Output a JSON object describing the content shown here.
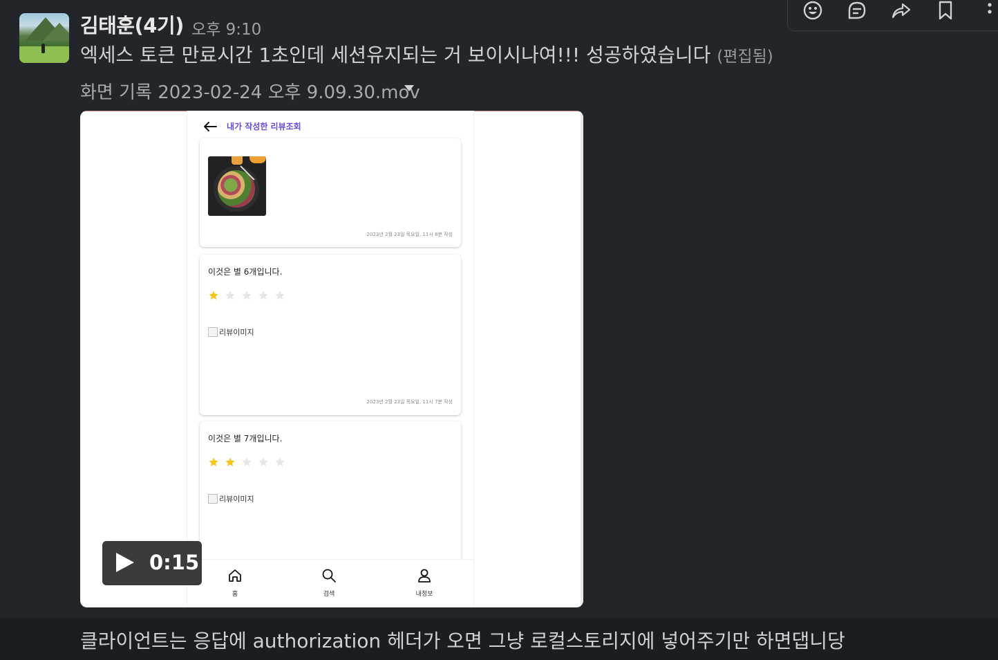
{
  "message": {
    "sender": "김태훈(4기)",
    "time": "오후 9:10",
    "text": "엑세스 토큰 만료시간 1초인데 세션유지되는 거 보이시나여!!! 성공하였습니다",
    "edited_label": "(편집됨)",
    "attachment_name": "화면 기록 2023-02-24 오후 9.09.30.mov",
    "video_duration": "0:15"
  },
  "toolbar": {
    "icons": [
      "emoji-icon",
      "reply-thread-icon",
      "share-icon",
      "bookmark-icon",
      "more-icon"
    ]
  },
  "app": {
    "header_title": "내가 작성한 리뷰조회",
    "cards": [
      {
        "date": "2023년 2월 23일 목요일, 11시 8분 작성"
      },
      {
        "text": "이것은 별 6개입니다.",
        "rating": 1,
        "image_alt": "리뷰이미지",
        "date": "2023년 2월 23일 목요일, 11시 7분 작성"
      },
      {
        "text": "이것은 별 7개입니다.",
        "rating": 2,
        "image_alt": "리뷰이미지"
      }
    ],
    "nav": [
      {
        "label": "홈",
        "icon": "home-icon"
      },
      {
        "label": "검색",
        "icon": "search-icon"
      },
      {
        "label": "내정보",
        "icon": "user-icon"
      }
    ],
    "star_color": "#f5c518",
    "star_empty_color": "#e6e6e6",
    "accent": "#6a4ad6"
  },
  "next_message": {
    "text": "클라이언트는 응답에 authorization 헤더가 오면 그냥 로컬스토리지에 넣어주기만 하면댑니당"
  }
}
